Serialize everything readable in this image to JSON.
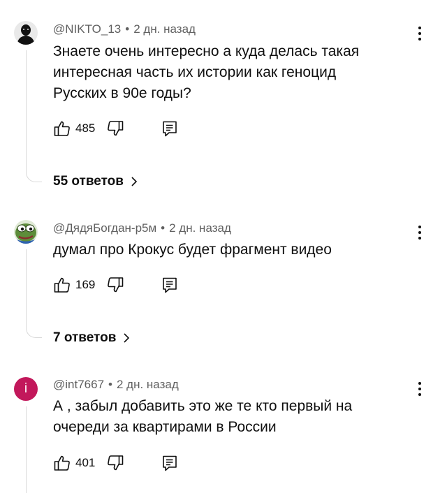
{
  "comments": [
    {
      "author": "@NIKTO_13",
      "separator": "•",
      "time": "2 дн. назад",
      "lines": [
        "Знаете очень интересно а куда делась такая",
        "интересная часть их истории как геноцид",
        "Русских в 90е годы?"
      ],
      "likes": "485",
      "replies": "55 ответов",
      "avatar_icon": "masked-person-avatar"
    },
    {
      "author": "@ДядяБогдан-р5м",
      "separator": "•",
      "time": "2 дн. назад",
      "lines": [
        "думал про Крокус будет фрагмент видео"
      ],
      "likes": "169",
      "replies": "7 ответов",
      "avatar_icon": "pepe-frog-avatar"
    },
    {
      "author": "@int7667",
      "separator": "•",
      "time": "2 дн. назад",
      "lines": [
        "А , забыл добавить это же те кто первый на",
        "очереди за квартирами в России"
      ],
      "likes": "401",
      "avatar_letter": "i",
      "avatar_color": "#c2185b"
    }
  ],
  "icons": {
    "like": "thumb-up-icon",
    "dislike": "thumb-down-icon",
    "reply": "reply-icon",
    "more": "more-vertical-icon",
    "chevron": "chevron-right-icon"
  }
}
